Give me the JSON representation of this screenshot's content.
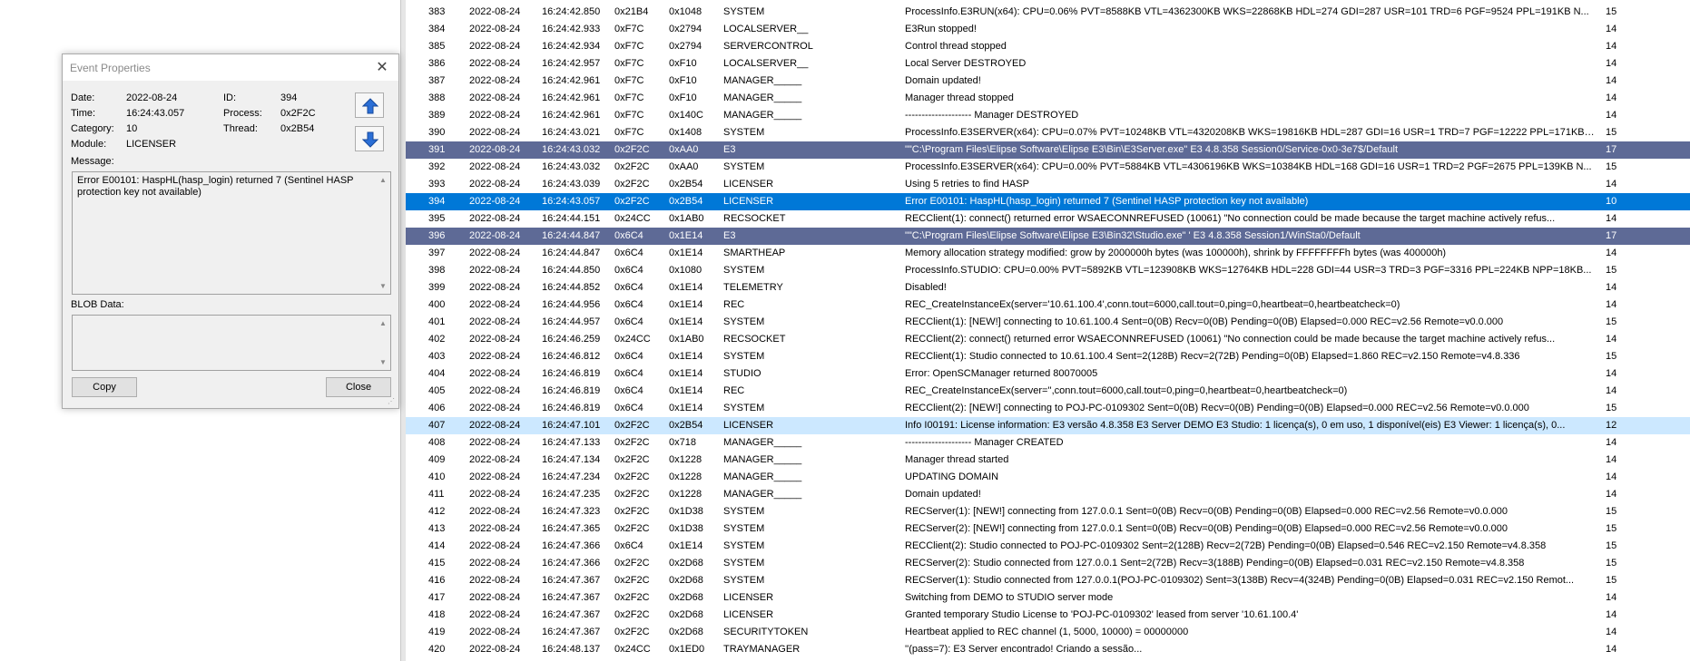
{
  "dialog": {
    "title": "Event Properties",
    "date_label": "Date:",
    "date_value": "2022-08-24",
    "time_label": "Time:",
    "time_value": "16:24:43.057",
    "category_label": "Category:",
    "category_value": "10",
    "module_label": "Module:",
    "module_value": "LICENSER",
    "id_label": "ID:",
    "id_value": "394",
    "process_label": "Process:",
    "process_value": "0x2F2C",
    "thread_label": "Thread:",
    "thread_value": "0x2B54",
    "message_label": "Message:",
    "message_text": "Error E00101: HaspHL(hasp_login) returned 7 (Sentinel HASP protection key not available)",
    "blob_label": "BLOB Data:",
    "blob_text": "",
    "copy_label": "Copy",
    "close_label": "Close"
  },
  "rows": [
    {
      "num": "383",
      "date": "2022-08-24",
      "time": "16:24:42.850",
      "pid": "0x21B4",
      "tid": "0x1048",
      "module": "SYSTEM",
      "msg": "ProcessInfo.E3RUN(x64): CPU=0.06% PVT=8588KB VTL=4362300KB WKS=22868KB HDL=274 GDI=287 USR=101 TRD=6 PGF=9524 PPL=191KB N...",
      "level": "15",
      "hl": ""
    },
    {
      "num": "384",
      "date": "2022-08-24",
      "time": "16:24:42.933",
      "pid": "0xF7C",
      "tid": "0x2794",
      "module": "LOCALSERVER__",
      "msg": "E3Run stopped!",
      "level": "14",
      "hl": ""
    },
    {
      "num": "385",
      "date": "2022-08-24",
      "time": "16:24:42.934",
      "pid": "0xF7C",
      "tid": "0x2794",
      "module": "SERVERCONTROL",
      "msg": "Control thread stopped",
      "level": "14",
      "hl": ""
    },
    {
      "num": "386",
      "date": "2022-08-24",
      "time": "16:24:42.957",
      "pid": "0xF7C",
      "tid": "0xF10",
      "module": "LOCALSERVER__",
      "msg": "Local Server DESTROYED",
      "level": "14",
      "hl": ""
    },
    {
      "num": "387",
      "date": "2022-08-24",
      "time": "16:24:42.961",
      "pid": "0xF7C",
      "tid": "0xF10",
      "module": "MANAGER_____",
      "msg": "Domain updated!",
      "level": "14",
      "hl": ""
    },
    {
      "num": "388",
      "date": "2022-08-24",
      "time": "16:24:42.961",
      "pid": "0xF7C",
      "tid": "0xF10",
      "module": "MANAGER_____",
      "msg": "Manager thread stopped",
      "level": "14",
      "hl": ""
    },
    {
      "num": "389",
      "date": "2022-08-24",
      "time": "16:24:42.961",
      "pid": "0xF7C",
      "tid": "0x140C",
      "module": "MANAGER_____",
      "msg": "-------------------- Manager DESTROYED",
      "level": "14",
      "hl": ""
    },
    {
      "num": "390",
      "date": "2022-08-24",
      "time": "16:24:43.021",
      "pid": "0xF7C",
      "tid": "0x1408",
      "module": "SYSTEM",
      "msg": "ProcessInfo.E3SERVER(x64): CPU=0.07% PVT=10248KB VTL=4320208KB WKS=19816KB HDL=287 GDI=16 USR=1 TRD=7 PGF=12222 PPL=171KB ...",
      "level": "15",
      "hl": ""
    },
    {
      "num": "391",
      "date": "2022-08-24",
      "time": "16:24:43.032",
      "pid": "0x2F2C",
      "tid": "0xAA0",
      "module": "E3",
      "msg": "\"\"C:\\Program Files\\Elipse Software\\Elipse E3\\Bin\\E3Server.exe\" E3 4.8.358 Session0/Service-0x0-3e7$/Default",
      "level": "17",
      "hl": "hl-dark"
    },
    {
      "num": "392",
      "date": "2022-08-24",
      "time": "16:24:43.032",
      "pid": "0x2F2C",
      "tid": "0xAA0",
      "module": "SYSTEM",
      "msg": "ProcessInfo.E3SERVER(x64): CPU=0.00% PVT=5884KB VTL=4306196KB WKS=10384KB HDL=168 GDI=16 USR=1 TRD=2 PGF=2675 PPL=139KB N...",
      "level": "15",
      "hl": ""
    },
    {
      "num": "393",
      "date": "2022-08-24",
      "time": "16:24:43.039",
      "pid": "0x2F2C",
      "tid": "0x2B54",
      "module": "LICENSER",
      "msg": "Using 5 retries to find HASP",
      "level": "14",
      "hl": ""
    },
    {
      "num": "394",
      "date": "2022-08-24",
      "time": "16:24:43.057",
      "pid": "0x2F2C",
      "tid": "0x2B54",
      "module": "LICENSER",
      "msg": "Error E00101: HaspHL(hasp_login) returned 7 (Sentinel HASP protection key not available)",
      "level": "10",
      "hl": "hl-sel"
    },
    {
      "num": "395",
      "date": "2022-08-24",
      "time": "16:24:44.151",
      "pid": "0x24CC",
      "tid": "0x1AB0",
      "module": "RECSOCKET",
      "msg": "RECClient(1): connect() returned error WSAECONNREFUSED (10061) \"No connection could be made because the target machine actively refus...",
      "level": "14",
      "hl": ""
    },
    {
      "num": "396",
      "date": "2022-08-24",
      "time": "16:24:44.847",
      "pid": "0x6C4",
      "tid": "0x1E14",
      "module": "E3",
      "msg": "\"\"C:\\Program Files\\Elipse Software\\Elipse E3\\Bin32\\Studio.exe\" ' E3 4.8.358 Session1/WinSta0/Default",
      "level": "17",
      "hl": "hl-dark"
    },
    {
      "num": "397",
      "date": "2022-08-24",
      "time": "16:24:44.847",
      "pid": "0x6C4",
      "tid": "0x1E14",
      "module": "SMARTHEAP",
      "msg": "Memory allocation strategy modified: grow by 2000000h bytes (was 100000h), shrink by FFFFFFFFh bytes (was 400000h)",
      "level": "14",
      "hl": ""
    },
    {
      "num": "398",
      "date": "2022-08-24",
      "time": "16:24:44.850",
      "pid": "0x6C4",
      "tid": "0x1080",
      "module": "SYSTEM",
      "msg": "ProcessInfo.STUDIO: CPU=0.00% PVT=5892KB VTL=123908KB WKS=12764KB HDL=228 GDI=44 USR=3 TRD=3 PGF=3316 PPL=224KB NPP=18KB...",
      "level": "15",
      "hl": ""
    },
    {
      "num": "399",
      "date": "2022-08-24",
      "time": "16:24:44.852",
      "pid": "0x6C4",
      "tid": "0x1E14",
      "module": "TELEMETRY",
      "msg": "Disabled!",
      "level": "14",
      "hl": ""
    },
    {
      "num": "400",
      "date": "2022-08-24",
      "time": "16:24:44.956",
      "pid": "0x6C4",
      "tid": "0x1E14",
      "module": "REC",
      "msg": "REC_CreateInstanceEx(server='10.61.100.4',conn.tout=6000,call.tout=0,ping=0,heartbeat=0,heartbeatcheck=0)",
      "level": "14",
      "hl": ""
    },
    {
      "num": "401",
      "date": "2022-08-24",
      "time": "16:24:44.957",
      "pid": "0x6C4",
      "tid": "0x1E14",
      "module": "SYSTEM",
      "msg": "RECClient(1): [NEW!] connecting to 10.61.100.4 Sent=0(0B) Recv=0(0B) Pending=0(0B) Elapsed=0.000 REC=v2.56 Remote=v0.0.000",
      "level": "15",
      "hl": ""
    },
    {
      "num": "402",
      "date": "2022-08-24",
      "time": "16:24:46.259",
      "pid": "0x24CC",
      "tid": "0x1AB0",
      "module": "RECSOCKET",
      "msg": "RECClient(2): connect() returned error WSAECONNREFUSED (10061) \"No connection could be made because the target machine actively refus...",
      "level": "14",
      "hl": ""
    },
    {
      "num": "403",
      "date": "2022-08-24",
      "time": "16:24:46.812",
      "pid": "0x6C4",
      "tid": "0x1E14",
      "module": "SYSTEM",
      "msg": "RECClient(1): Studio connected to 10.61.100.4 Sent=2(128B) Recv=2(72B) Pending=0(0B) Elapsed=1.860 REC=v2.150 Remote=v4.8.336",
      "level": "15",
      "hl": ""
    },
    {
      "num": "404",
      "date": "2022-08-24",
      "time": "16:24:46.819",
      "pid": "0x6C4",
      "tid": "0x1E14",
      "module": "STUDIO",
      "msg": "Error: OpenSCManager returned 80070005",
      "level": "14",
      "hl": ""
    },
    {
      "num": "405",
      "date": "2022-08-24",
      "time": "16:24:46.819",
      "pid": "0x6C4",
      "tid": "0x1E14",
      "module": "REC",
      "msg": "REC_CreateInstanceEx(server='',conn.tout=6000,call.tout=0,ping=0,heartbeat=0,heartbeatcheck=0)",
      "level": "14",
      "hl": ""
    },
    {
      "num": "406",
      "date": "2022-08-24",
      "time": "16:24:46.819",
      "pid": "0x6C4",
      "tid": "0x1E14",
      "module": "SYSTEM",
      "msg": "RECClient(2): [NEW!] connecting to POJ-PC-0109302 Sent=0(0B) Recv=0(0B) Pending=0(0B) Elapsed=0.000 REC=v2.56 Remote=v0.0.000",
      "level": "15",
      "hl": ""
    },
    {
      "num": "407",
      "date": "2022-08-24",
      "time": "16:24:47.101",
      "pid": "0x2F2C",
      "tid": "0x2B54",
      "module": "LICENSER",
      "msg": "Info I00191: License information: E3 versão 4.8.358  E3 Server DEMO  E3 Studio: 1 licença(s), 0 em uso, 1 disponível(eis)  E3 Viewer: 1 licença(s), 0...",
      "level": "12",
      "hl": "hl-light"
    },
    {
      "num": "408",
      "date": "2022-08-24",
      "time": "16:24:47.133",
      "pid": "0x2F2C",
      "tid": "0x718",
      "module": "MANAGER_____",
      "msg": "-------------------- Manager CREATED",
      "level": "14",
      "hl": ""
    },
    {
      "num": "409",
      "date": "2022-08-24",
      "time": "16:24:47.134",
      "pid": "0x2F2C",
      "tid": "0x1228",
      "module": "MANAGER_____",
      "msg": "Manager thread started",
      "level": "14",
      "hl": ""
    },
    {
      "num": "410",
      "date": "2022-08-24",
      "time": "16:24:47.234",
      "pid": "0x2F2C",
      "tid": "0x1228",
      "module": "MANAGER_____",
      "msg": "UPDATING DOMAIN",
      "level": "14",
      "hl": ""
    },
    {
      "num": "411",
      "date": "2022-08-24",
      "time": "16:24:47.235",
      "pid": "0x2F2C",
      "tid": "0x1228",
      "module": "MANAGER_____",
      "msg": "Domain updated!",
      "level": "14",
      "hl": ""
    },
    {
      "num": "412",
      "date": "2022-08-24",
      "time": "16:24:47.323",
      "pid": "0x2F2C",
      "tid": "0x1D38",
      "module": "SYSTEM",
      "msg": "RECServer(1): [NEW!] connecting from 127.0.0.1 Sent=0(0B) Recv=0(0B) Pending=0(0B) Elapsed=0.000 REC=v2.56 Remote=v0.0.000",
      "level": "15",
      "hl": ""
    },
    {
      "num": "413",
      "date": "2022-08-24",
      "time": "16:24:47.365",
      "pid": "0x2F2C",
      "tid": "0x1D38",
      "module": "SYSTEM",
      "msg": "RECServer(2): [NEW!] connecting from 127.0.0.1 Sent=0(0B) Recv=0(0B) Pending=0(0B) Elapsed=0.000 REC=v2.56 Remote=v0.0.000",
      "level": "15",
      "hl": ""
    },
    {
      "num": "414",
      "date": "2022-08-24",
      "time": "16:24:47.366",
      "pid": "0x6C4",
      "tid": "0x1E14",
      "module": "SYSTEM",
      "msg": "RECClient(2): Studio connected to POJ-PC-0109302 Sent=2(128B) Recv=2(72B) Pending=0(0B) Elapsed=0.546 REC=v2.150 Remote=v4.8.358",
      "level": "15",
      "hl": ""
    },
    {
      "num": "415",
      "date": "2022-08-24",
      "time": "16:24:47.366",
      "pid": "0x2F2C",
      "tid": "0x2D68",
      "module": "SYSTEM",
      "msg": "RECServer(2): Studio connected from 127.0.0.1 Sent=2(72B) Recv=3(188B) Pending=0(0B) Elapsed=0.031 REC=v2.150 Remote=v4.8.358",
      "level": "15",
      "hl": ""
    },
    {
      "num": "416",
      "date": "2022-08-24",
      "time": "16:24:47.367",
      "pid": "0x2F2C",
      "tid": "0x2D68",
      "module": "SYSTEM",
      "msg": "RECServer(1): Studio connected from 127.0.0.1(POJ-PC-0109302) Sent=3(138B) Recv=4(324B) Pending=0(0B) Elapsed=0.031 REC=v2.150 Remot...",
      "level": "15",
      "hl": ""
    },
    {
      "num": "417",
      "date": "2022-08-24",
      "time": "16:24:47.367",
      "pid": "0x2F2C",
      "tid": "0x2D68",
      "module": "LICENSER",
      "msg": "Switching from DEMO to STUDIO server mode",
      "level": "14",
      "hl": ""
    },
    {
      "num": "418",
      "date": "2022-08-24",
      "time": "16:24:47.367",
      "pid": "0x2F2C",
      "tid": "0x2D68",
      "module": "LICENSER",
      "msg": "Granted temporary Studio License to 'POJ-PC-0109302' leased from server '10.61.100.4'",
      "level": "14",
      "hl": ""
    },
    {
      "num": "419",
      "date": "2022-08-24",
      "time": "16:24:47.367",
      "pid": "0x2F2C",
      "tid": "0x2D68",
      "module": "SECURITYTOKEN",
      "msg": "Heartbeat applied to REC channel (1, 5000, 10000) = 00000000",
      "level": "14",
      "hl": ""
    },
    {
      "num": "420",
      "date": "2022-08-24",
      "time": "16:24:48.137",
      "pid": "0x24CC",
      "tid": "0x1ED0",
      "module": "TRAYMANAGER",
      "msg": "''(pass=7): E3 Server encontrado! Criando a sessão...",
      "level": "14",
      "hl": ""
    }
  ]
}
